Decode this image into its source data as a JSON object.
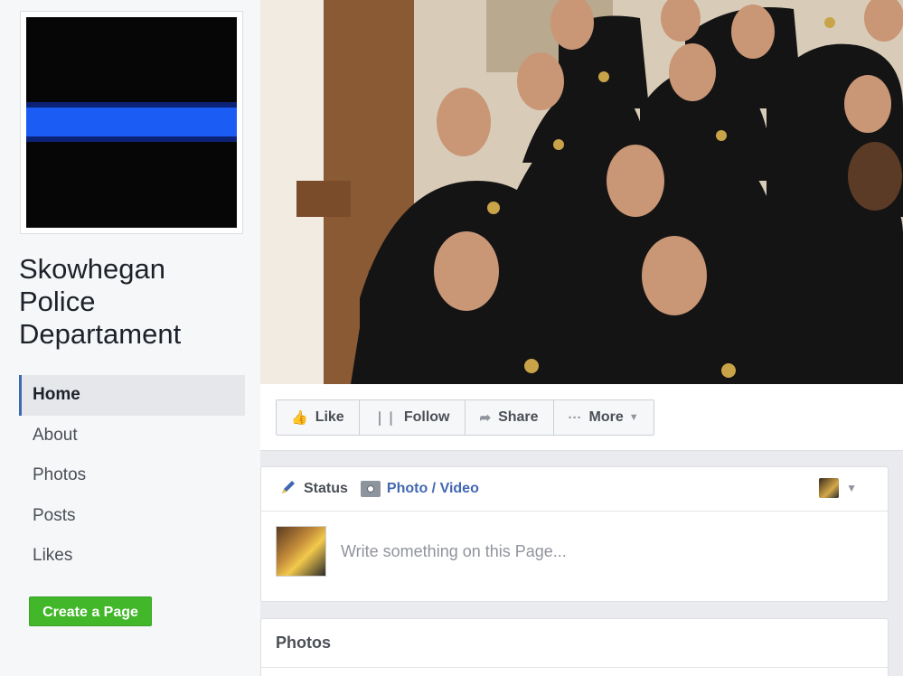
{
  "page": {
    "name": "Skowhegan Police Departament"
  },
  "nav": {
    "items": [
      {
        "label": "Home",
        "active": true
      },
      {
        "label": "About"
      },
      {
        "label": "Photos"
      },
      {
        "label": "Posts"
      },
      {
        "label": "Likes"
      }
    ],
    "create_page": "Create a Page"
  },
  "actions": {
    "like": "Like",
    "follow": "Follow",
    "share": "Share",
    "more": "More"
  },
  "composer": {
    "status_tab": "Status",
    "photo_tab": "Photo / Video",
    "placeholder": "Write something on this Page..."
  },
  "photos": {
    "title": "Photos"
  },
  "colors": {
    "brand": "#4267b2",
    "green": "#42b72a",
    "thin_blue_line": "#1b5cf5"
  }
}
